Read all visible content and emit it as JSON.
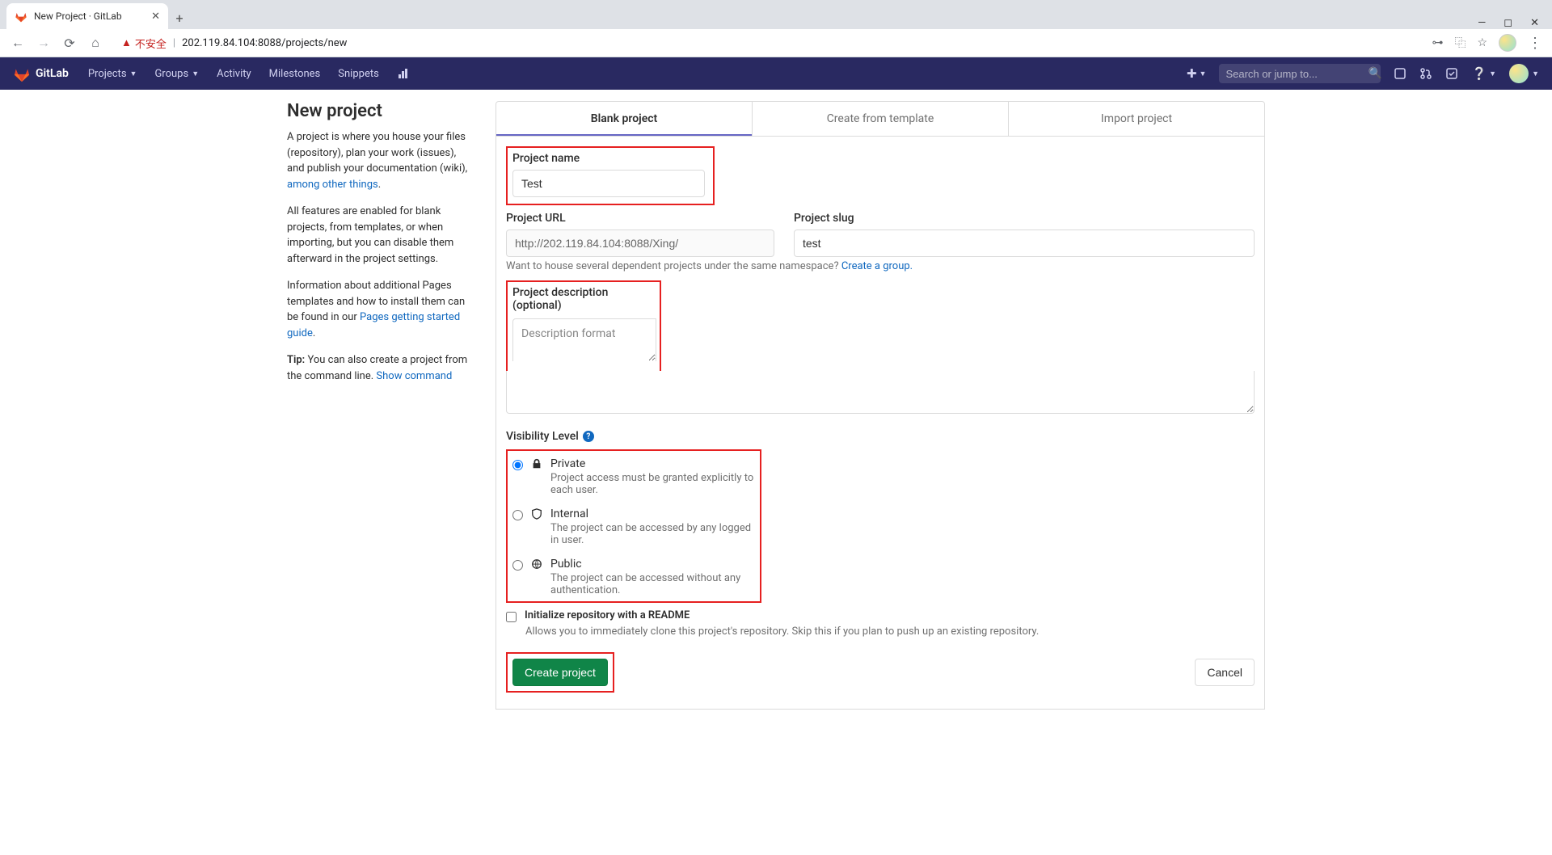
{
  "browser": {
    "tab_title": "New Project · GitLab",
    "insecure_label": "不安全",
    "url": "202.119.84.104:8088/projects/new"
  },
  "navbar": {
    "brand": "GitLab",
    "links": {
      "projects": "Projects",
      "groups": "Groups",
      "activity": "Activity",
      "milestones": "Milestones",
      "snippets": "Snippets"
    },
    "search_placeholder": "Search or jump to..."
  },
  "sidebar": {
    "heading": "New project",
    "p1_a": "A project is where you house your files (repository), plan your work (issues), and publish your documentation (wiki), ",
    "p1_link": "among other things",
    "p1_b": ".",
    "p2": "All features are enabled for blank projects, from templates, or when importing, but you can disable them afterward in the project settings.",
    "p3_a": "Information about additional Pages templates and how to install them can be found in our ",
    "p3_link": "Pages getting started guide",
    "p3_b": ".",
    "tip_label": "Tip:",
    "tip_text": " You can also create a project from the command line. ",
    "tip_link": "Show command"
  },
  "tabs": {
    "blank": "Blank project",
    "template": "Create from template",
    "import": "Import project"
  },
  "form": {
    "name_label": "Project name",
    "name_value": "Test",
    "url_label": "Project URL",
    "url_value": "http://202.119.84.104:8088/Xing/",
    "slug_label": "Project slug",
    "slug_value": "test",
    "namespace_hint_a": "Want to house several dependent projects under the same namespace? ",
    "namespace_hint_link": "Create a group.",
    "desc_label": "Project description (optional)",
    "desc_placeholder": "Description format",
    "vis_label": "Visibility Level",
    "vis": {
      "private_title": "Private",
      "private_desc": "Project access must be granted explicitly to each user.",
      "internal_title": "Internal",
      "internal_desc": "The project can be accessed by any logged in user.",
      "public_title": "Public",
      "public_desc": "The project can be accessed without any authentication."
    },
    "readme_label": "Initialize repository with a README",
    "readme_desc": "Allows you to immediately clone this project's repository. Skip this if you plan to push up an existing repository.",
    "create_btn": "Create project",
    "cancel_btn": "Cancel"
  }
}
